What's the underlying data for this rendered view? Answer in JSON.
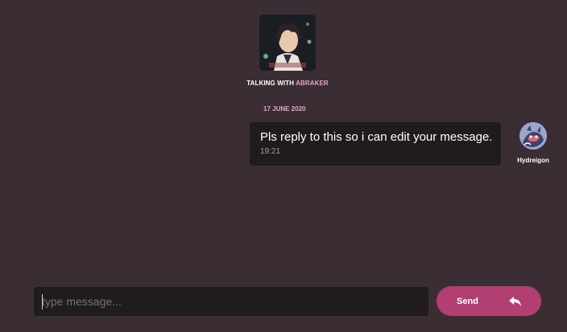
{
  "header": {
    "talking_with_prefix": "TALKING WITH",
    "talking_with_name": "ABRAKER",
    "avatar_icon": "user-avatar-icon"
  },
  "conversation": {
    "date": "17 JUNE 2020",
    "messages": [
      {
        "text": "Pls reply to this so i can edit your message.",
        "time": "19:21",
        "sender": "Hydreigon"
      }
    ]
  },
  "composer": {
    "placeholder": "type message...",
    "value": "",
    "send_label": "Send",
    "send_icon": "reply-arrow-icon"
  },
  "colors": {
    "background": "#3a2e34",
    "accent": "#e7a3c8",
    "send_button": "#b23f72",
    "surface": "#1f1b1e"
  }
}
